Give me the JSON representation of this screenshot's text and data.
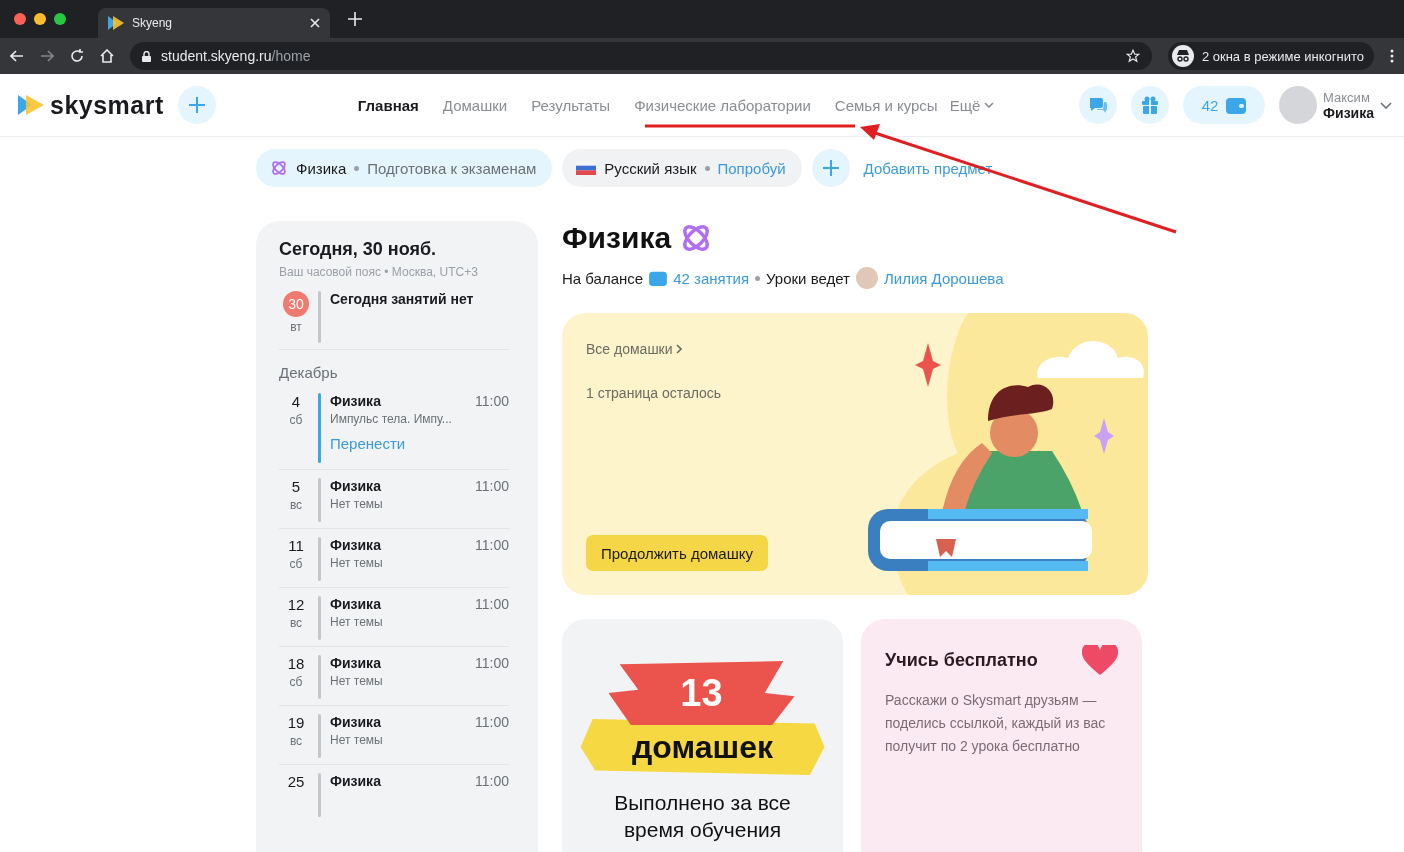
{
  "browser": {
    "tab_title": "Skyeng",
    "url_host": "student.skyeng.ru",
    "url_path": "/home",
    "incognito": "2 окна в режиме инкогнито"
  },
  "header": {
    "logo": "skysmart",
    "nav": [
      {
        "label": "Главная",
        "selected": true
      },
      {
        "label": "Домашки",
        "selected": false
      },
      {
        "label": "Результаты",
        "selected": false
      },
      {
        "label": "Физические лаборатории",
        "selected": false
      },
      {
        "label": "Семья и курсы",
        "selected": false
      }
    ],
    "more": "Ещё",
    "balance": "42",
    "user": {
      "name": "Максим",
      "subject": "Физика"
    }
  },
  "subjects": [
    {
      "kind": "physics",
      "name": "Физика",
      "note": "Подготовка к экзаменам",
      "selected": true
    },
    {
      "kind": "flag",
      "name": "Русский язык",
      "note": "Попробуй",
      "selected": false
    }
  ],
  "add_subject": "Добавить предмет",
  "schedule": {
    "title": "Сегодня, 30 нояб.",
    "timezone": "Ваш часовой пояс • Москва, UTC+3",
    "today": {
      "day": "30",
      "weekday": "вт",
      "text": "Сегодня занятий нет"
    },
    "month": "Декабрь",
    "lessons": [
      {
        "day": "4",
        "weekday": "сб",
        "subject": "Физика",
        "time": "11:00",
        "topic": "Импульс тела. Импу...",
        "action": "Перенести",
        "highlighted": true
      },
      {
        "day": "5",
        "weekday": "вс",
        "subject": "Физика",
        "time": "11:00",
        "topic": "Нет темы",
        "highlighted": false
      },
      {
        "day": "11",
        "weekday": "сб",
        "subject": "Физика",
        "time": "11:00",
        "topic": "Нет темы",
        "highlighted": false
      },
      {
        "day": "12",
        "weekday": "вс",
        "subject": "Физика",
        "time": "11:00",
        "topic": "Нет темы",
        "highlighted": false
      },
      {
        "day": "18",
        "weekday": "сб",
        "subject": "Физика",
        "time": "11:00",
        "topic": "Нет темы",
        "highlighted": false
      },
      {
        "day": "19",
        "weekday": "вс",
        "subject": "Физика",
        "time": "11:00",
        "topic": "Нет темы",
        "highlighted": false
      },
      {
        "day": "25",
        "subject": "Физика",
        "time": "11:00",
        "highlighted": false
      }
    ]
  },
  "course": {
    "title": "Физика",
    "balance_label": "На балансе",
    "balance_value": "42 занятия",
    "teacher_label": "Уроки ведет",
    "teacher": "Лилия Дорошева"
  },
  "homework": {
    "link": "Все домашки",
    "remaining": "1 страница осталось",
    "button": "Продолжить домашку"
  },
  "stats": {
    "number": "13",
    "word": "домашек",
    "caption": "Выполнено за все время обучения"
  },
  "referral": {
    "title": "Учись бесплатно",
    "text": "Расскажи о Skysmart друзьям — поделись ссылкой, каждый из вас получит по 2 урока бесплатно"
  }
}
